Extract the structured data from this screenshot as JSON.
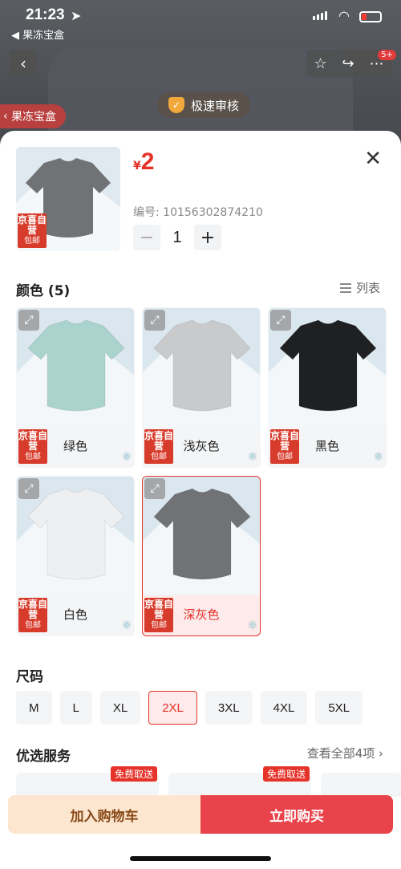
{
  "status_bar": {
    "time": "21:23",
    "back_app": "◀ 果冻宝盒"
  },
  "background": {
    "verify_label": "极速审核",
    "shop_tag": "果冻宝盒",
    "cart_badge": "5+"
  },
  "product": {
    "currency": "¥",
    "price": "2",
    "sku_label": "编号: 10156302874210",
    "quantity": "1"
  },
  "colors": {
    "title": "颜色 (5)",
    "list_view_label": "列表",
    "promo_line1": "京喜自营",
    "promo_line2": "包邮",
    "items": [
      {
        "label": "绿色",
        "shirt_color": "#a9d3cc"
      },
      {
        "label": "浅灰色",
        "shirt_color": "#c9cacc"
      },
      {
        "label": "黑色",
        "shirt_color": "#1f2022"
      },
      {
        "label": "白色",
        "shirt_color": "#eeeff0"
      },
      {
        "label": "深灰色",
        "shirt_color": "#707276",
        "selected": true
      }
    ]
  },
  "sizes": {
    "title": "尺码",
    "options": [
      "M",
      "L",
      "XL",
      "2XL",
      "3XL",
      "4XL",
      "5XL"
    ],
    "selected": "2XL"
  },
  "services": {
    "title": "优选服务",
    "see_all": "查看全部4项 ›",
    "free_tag": "免费取送"
  },
  "actions": {
    "add_to_cart": "加入购物车",
    "buy_now": "立即购买"
  },
  "theme": {
    "accent": "#e5332a"
  }
}
